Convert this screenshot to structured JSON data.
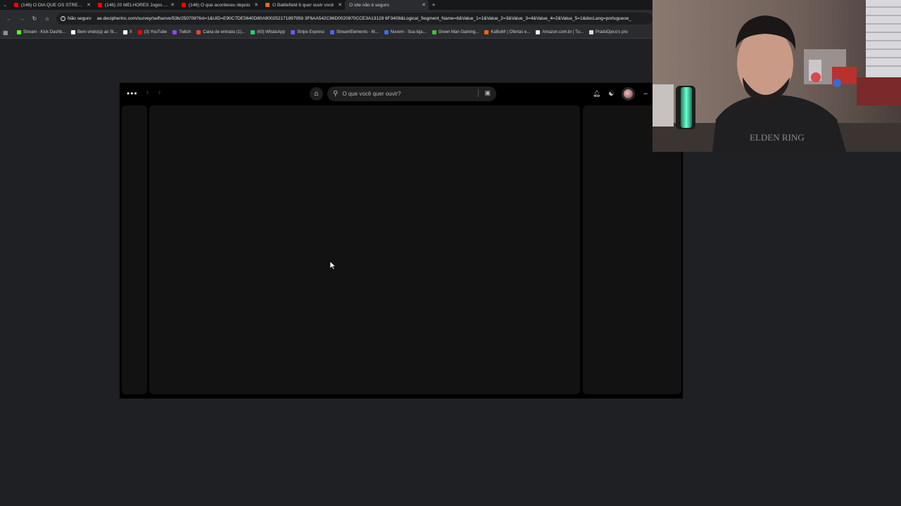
{
  "browser": {
    "tabs": [
      {
        "title": "(146) O DIA QUE OS STREAMI",
        "fav_color": "#ff0000",
        "active": false
      },
      {
        "title": "(146) 20 MELHORES Jogos de",
        "fav_color": "#ff0000",
        "active": false
      },
      {
        "title": "(146) O que aconteceu depois",
        "fav_color": "#ff0000",
        "active": false
      },
      {
        "title": "O Battlefield 6 quer ouvir você",
        "fav_color": "#e06a2a",
        "active": false
      },
      {
        "title": "O site não é seguro",
        "fav_color": "#888888",
        "active": true
      }
    ],
    "security_label": "Não seguro",
    "url": "ae.decipherinc.com/survey/selfserve/53b/250708?list=1&UID=E90C7DE5640D80A900252171897958 3F6AA542C86D0020870CCE3A13128 6F3408&Logical_Segment_Name=6&Value_1=1&Value_2=3&Value_3=4&Value_4=2&Value_5=1&decLang=portuguese_",
    "bookmarks": [
      {
        "label": "Stream - Kick Dashb...",
        "fav_color": "#53fc18"
      },
      {
        "label": "Bem-vindo(a) ao St...",
        "fav_color": "#ffffff"
      },
      {
        "label": "X",
        "fav_color": "#ffffff"
      },
      {
        "label": "(3) YouTube",
        "fav_color": "#ff0000"
      },
      {
        "label": "Twitch",
        "fav_color": "#9146ff"
      },
      {
        "label": "Caixa de entrada (1)...",
        "fav_color": "#ea4335"
      },
      {
        "label": "(63) WhatsApp",
        "fav_color": "#25d366"
      },
      {
        "label": "Stripe Express",
        "fav_color": "#635bff"
      },
      {
        "label": "StreamElements - M...",
        "fav_color": "#4a67ff"
      },
      {
        "label": "Nuvem - Sua loja...",
        "fav_color": "#3a6df0"
      },
      {
        "label": "Green Man Gaming...",
        "fav_color": "#3fbf3f"
      },
      {
        "label": "KaBuM! | Ofertas e...",
        "fav_color": "#ff6500"
      },
      {
        "label": "Amazon.com.br | Tu...",
        "fav_color": "#eeeeee"
      },
      {
        "label": "PradoDjeco's pro",
        "fav_color": "#dddddd"
      }
    ]
  },
  "spotify": {
    "search_placeholder": "O que você quer ouvir?"
  },
  "colors": {
    "page_bg": "#1f2023",
    "app_bg": "#000000",
    "panel_bg": "#121212"
  }
}
